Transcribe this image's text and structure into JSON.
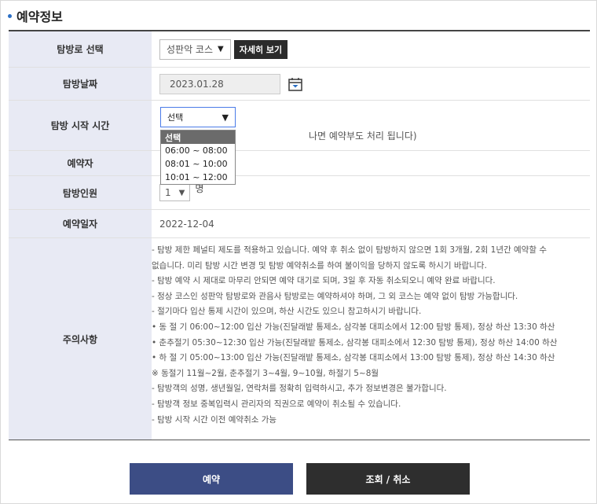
{
  "section": {
    "title": "예약정보"
  },
  "rows": {
    "course": {
      "label": "탐방로 선택",
      "value": "성판악 코스",
      "detail_button": "자세히 보기"
    },
    "date": {
      "label": "탐방날짜",
      "value": "2023.01.28"
    },
    "time": {
      "label": "탐방 시작 시간",
      "selected": "선택",
      "note": "나면 예약부도 처리 됩니다)",
      "options": [
        "선택",
        "06:00 ~ 08:00",
        "08:01 ~ 10:00",
        "10:01 ~ 12:00"
      ]
    },
    "name": {
      "label": "예약자"
    },
    "count": {
      "label": "탐방인원",
      "value": "1",
      "unit": "명"
    },
    "reserve_date": {
      "label": "예약일자",
      "value": "2022-12-04"
    },
    "notice": {
      "label": "주의사항",
      "lines": [
        "- 탐방 제한 페널티 제도를 적용하고 있습니다. 예약 후 취소 없이 탐방하지 않으면 1회 3개월, 2회 1년간 예약할 수",
        "   없습니다. 미리 탐방 시간 변경 및 탐방 예약취소를 하여 불이익을 당하지 않도록 하시기 바랍니다.",
        "- 탐방 예약 시 제대로 마무리 안되면 예약 대기로 되며, 3일 후 자동 취소되오니 예약 완료 바랍니다.",
        "- 정상 코스인 성판악 탐방로와 관음사 탐방로는 예약하셔야 하며, 그 외 코스는 예약 없이 탐방 가능합니다.",
        "- 절기마다 입산 통제 시간이 있으며, 하산 시간도 있으니 참고하시기 바랍니다.",
        "  • 동 절 기 06:00~12:00 입산 가능(진달래밭 통제소, 삼각봉 대피소에서 12:00 탐방 통제), 정상 하산 13:30 하산",
        "  • 춘추절기 05:30~12:30 입산 가능(진달래밭 통제소, 삼각봉 대피소에서 12:30 탐방 통제), 정상 하산 14:00 하산",
        "  • 하 절 기 05:00~13:00 입산 가능(진달래밭 통제소, 삼각봉 대피소에서 13:00 탐방 통제), 정상 하산 14:30 하산",
        "  ※ 동절기 11월~2월, 춘추절기 3~4월, 9~10월, 하절기 5~8월",
        "- 탐방객의 성명, 생년월일, 연락처를 정확히 입력하시고, 추가 정보변경은 불가합니다.",
        "- 탐방객 정보 중복입력시 관리자의 직권으로 예약이 취소될 수 있습니다.",
        "- 탐방 시작 시간 이전 예약취소 가능"
      ]
    }
  },
  "buttons": {
    "reserve": "예약",
    "lookup_cancel": "조회 / 취소"
  },
  "icons": {
    "calendar": "calendar-icon",
    "dropdown": "triangle-down-icon"
  },
  "colors": {
    "header_bg": "#e8eaf4",
    "reserve_button": "#3c4d85",
    "cancel_button": "#2e2e2e",
    "focus_border": "#4a7be8"
  }
}
